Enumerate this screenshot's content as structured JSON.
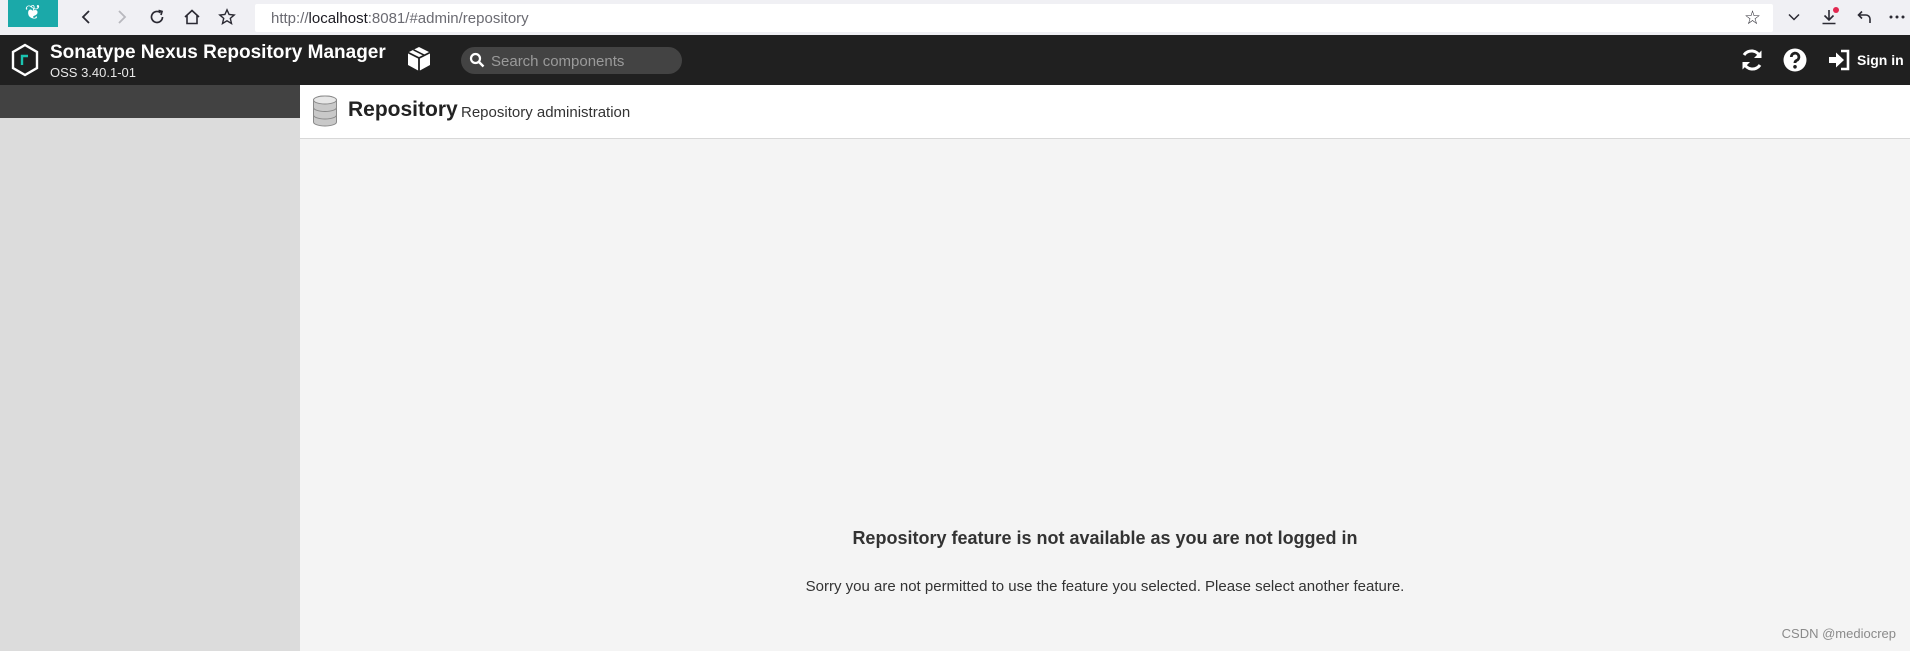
{
  "browser": {
    "url_prefix": "http://",
    "url_host": "localhost",
    "url_rest": ":8081/#admin/repository"
  },
  "app": {
    "name": "Sonatype Nexus Repository Manager",
    "version": "OSS 3.40.1-01",
    "search_placeholder": "Search components",
    "sign_in": "Sign in"
  },
  "page": {
    "title": "Repository",
    "subtitle": "Repository administration"
  },
  "message": {
    "title": "Repository feature is not available as you are not logged in",
    "body": "Sorry you are not permitted to use the feature you selected. Please select another feature."
  },
  "watermark": "CSDN @mediocrep",
  "colors": {
    "header_bg": "#202020",
    "sidebar_bg": "#dcdcdc",
    "favicon_bg": "#1ba9a9"
  }
}
